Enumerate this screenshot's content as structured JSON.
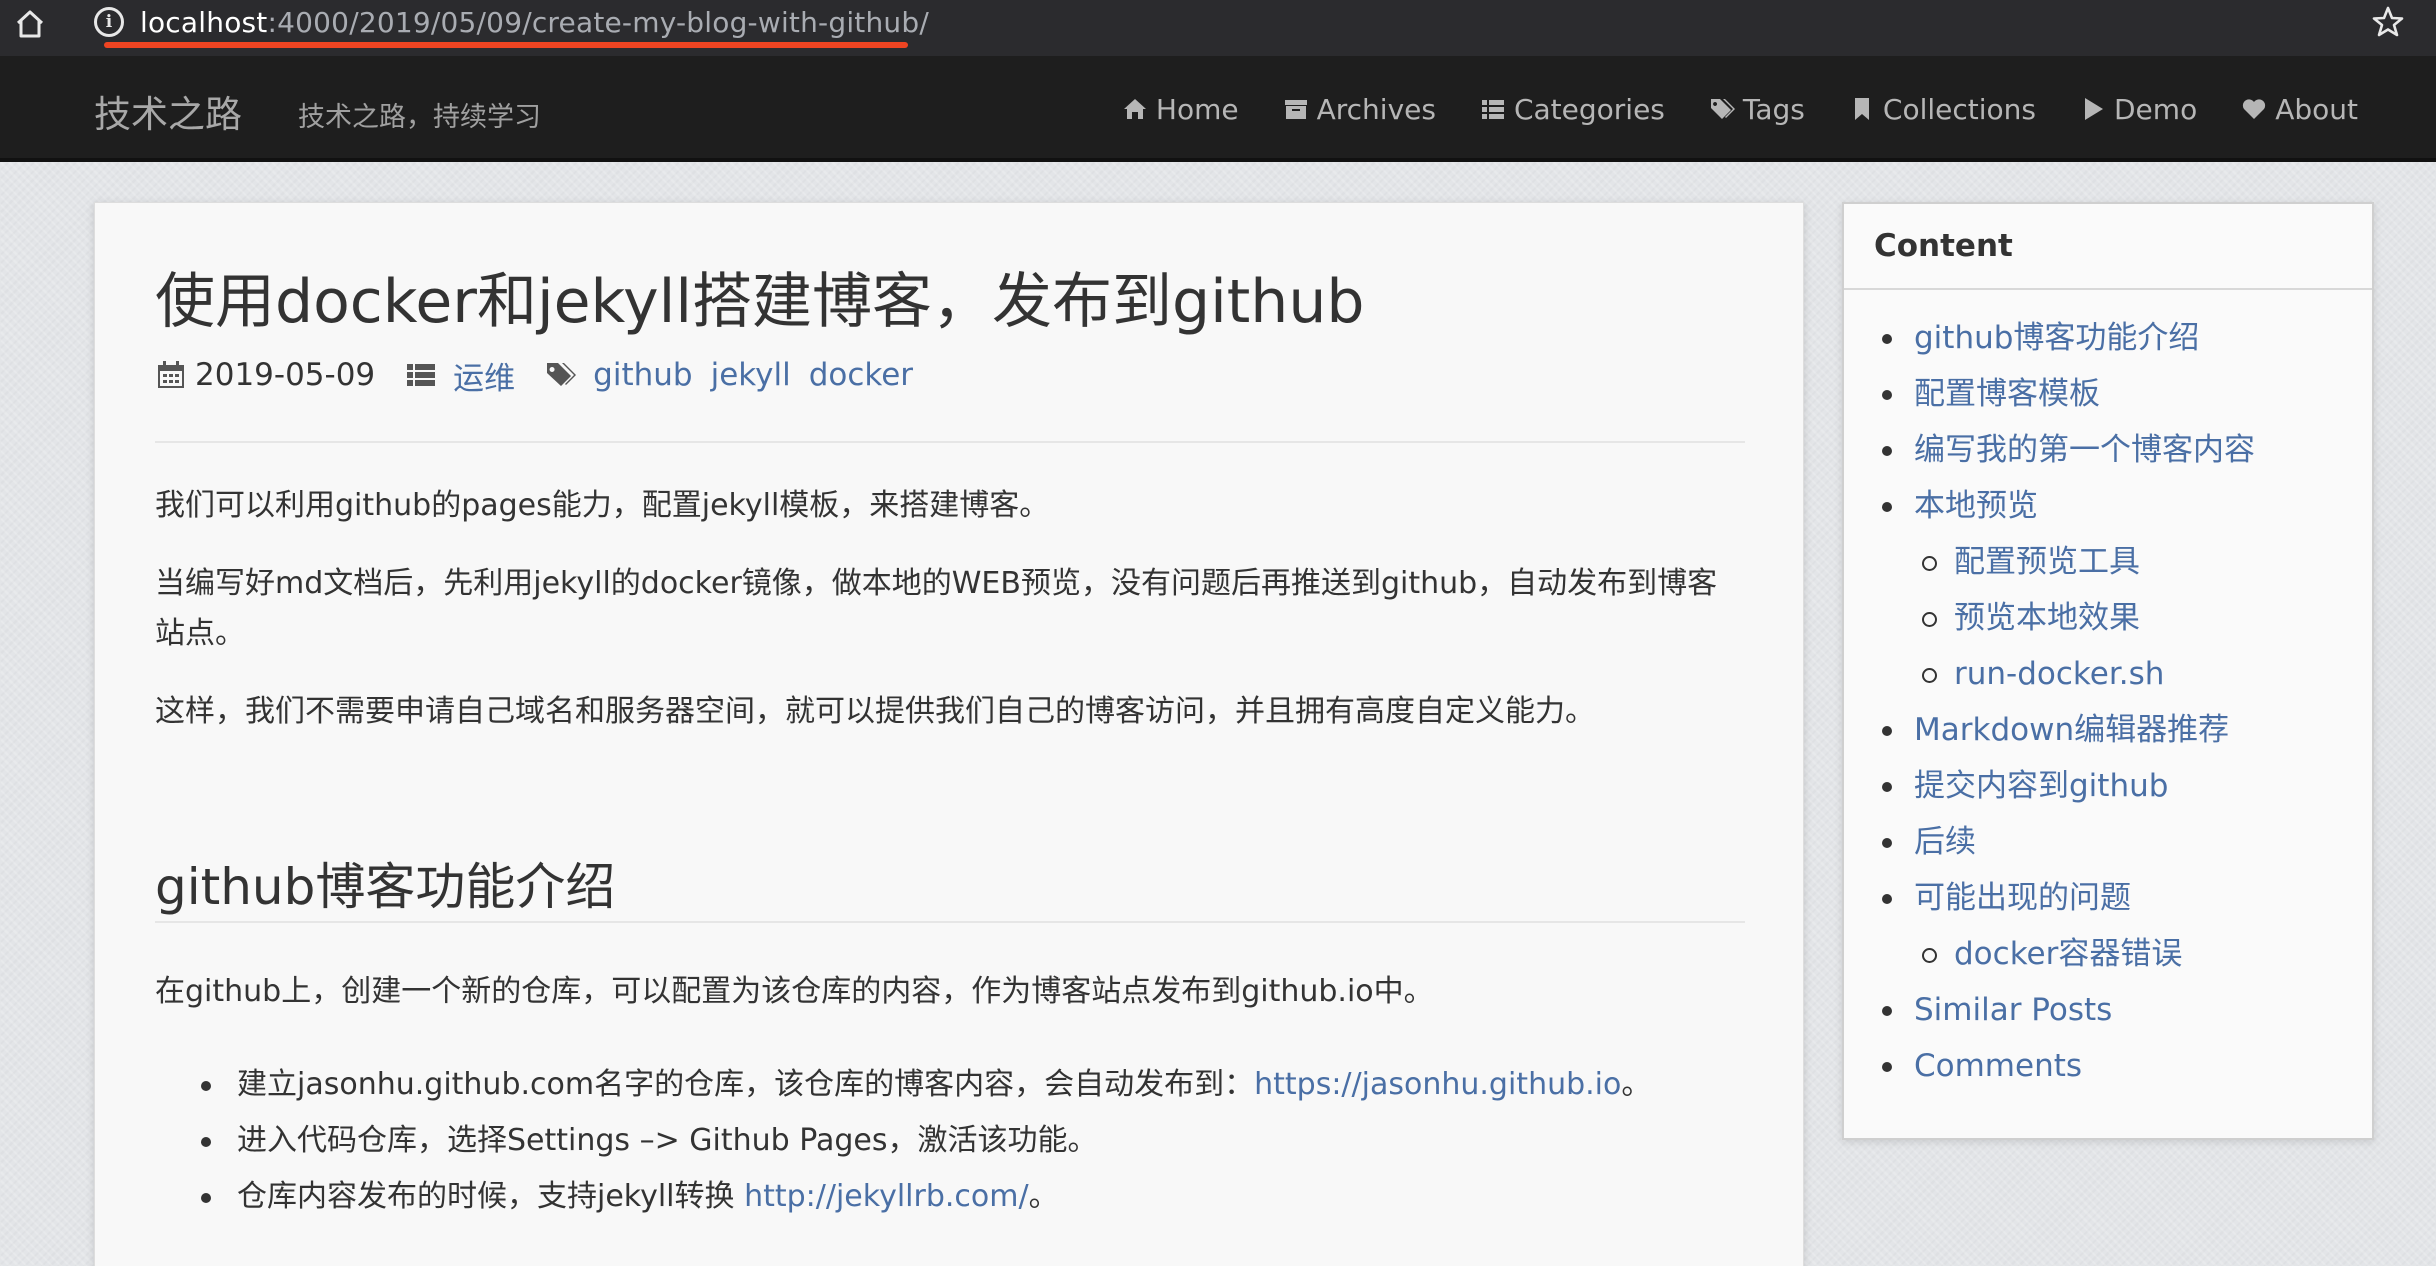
{
  "browser": {
    "url_host": "localhost",
    "url_path": ":4000/2019/05/09/create-my-blog-with-github/",
    "accent_underline": "#ee4422"
  },
  "site": {
    "brand": "技术之路",
    "tagline": "技术之路，持续学习",
    "nav": [
      {
        "label": "Home",
        "icon": "home-icon"
      },
      {
        "label": "Archives",
        "icon": "archive-icon"
      },
      {
        "label": "Categories",
        "icon": "list-icon"
      },
      {
        "label": "Tags",
        "icon": "tags-icon"
      },
      {
        "label": "Collections",
        "icon": "bookmark-icon"
      },
      {
        "label": "Demo",
        "icon": "play-icon"
      },
      {
        "label": "About",
        "icon": "heart-icon"
      }
    ]
  },
  "post": {
    "title": "使用docker和jekyll搭建博客，发布到github",
    "date": "2019-05-09",
    "category": "运维",
    "tags": [
      "github",
      "jekyll",
      "docker"
    ],
    "paragraphs": [
      "我们可以利用github的pages能力，配置jekyll模板，来搭建博客。",
      "当编写好md文档后，先利用jekyll的docker镜像，做本地的WEB预览，没有问题后再推送到github，自动发布到博客站点。",
      "这样，我们不需要申请自己域名和服务器空间，就可以提供我们自己的博客访问，并且拥有高度自定义能力。"
    ],
    "section_title": "github博客功能介绍",
    "section_intro": "在github上，创建一个新的仓库，可以配置为该仓库的内容，作为博客站点发布到github.io中。",
    "bullets": [
      {
        "text": "建立jasonhu.github.com名字的仓库，该仓库的博客内容，会自动发布到：",
        "link": "https://jasonhu.github.io",
        "suffix": "。"
      },
      {
        "text": "进入代码仓库，选择Settings –> Github Pages，激活该功能。",
        "link": "",
        "suffix": ""
      },
      {
        "text": "仓库内容发布的时候，支持jekyll转换 ",
        "link": "http://jekyllrb.com/",
        "suffix": "。"
      }
    ]
  },
  "toc": {
    "header": "Content",
    "items": [
      {
        "label": "github博客功能介绍",
        "level": 1
      },
      {
        "label": "配置博客模板",
        "level": 1
      },
      {
        "label": "编写我的第一个博客内容",
        "level": 1
      },
      {
        "label": "本地预览",
        "level": 1
      },
      {
        "label": "配置预览工具",
        "level": 2
      },
      {
        "label": "预览本地效果",
        "level": 2
      },
      {
        "label": "run-docker.sh",
        "level": 2
      },
      {
        "label": "Markdown编辑器推荐",
        "level": 1
      },
      {
        "label": "提交内容到github",
        "level": 1
      },
      {
        "label": "后续",
        "level": 1
      },
      {
        "label": "可能出现的问题",
        "level": 1
      },
      {
        "label": "docker容器错误",
        "level": 2
      },
      {
        "label": "Similar Posts",
        "level": 1
      },
      {
        "label": "Comments",
        "level": 1
      }
    ]
  },
  "colors": {
    "link": "#4a6fa5",
    "nav_bg": "#1e1e1e",
    "text": "#333333"
  }
}
